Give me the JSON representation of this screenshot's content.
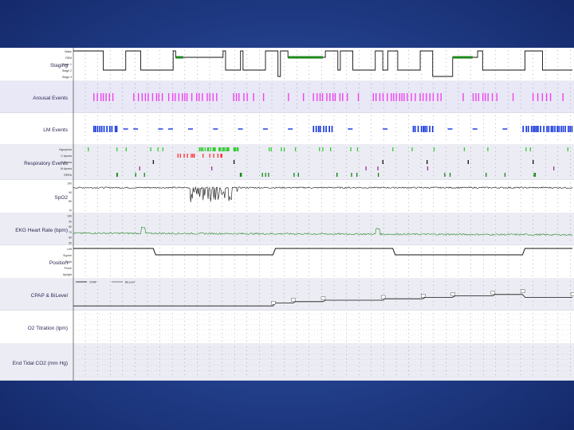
{
  "chart_data": {
    "type": "line",
    "title": "",
    "channels": [
      {
        "key": "staging",
        "label": "Staging",
        "scale_labels": [
          "Wake",
          "REM",
          "Stage 1",
          "Stage 2",
          "Stage 3"
        ],
        "description": "Hypnogram: sleep stage over time (0=Wake,1=REM,2=Stage 1,3=Stage 2,4=Stage 3)",
        "x_fraction": [
          0,
          0.05,
          0.06,
          0.1,
          0.105,
          0.13,
          0.135,
          0.14,
          0.2,
          0.205,
          0.22,
          0.3,
          0.305,
          0.33,
          0.335,
          0.34,
          0.38,
          0.385,
          0.41,
          0.415,
          0.43,
          0.5,
          0.505,
          0.53,
          0.535,
          0.56,
          0.6,
          0.605,
          0.62,
          0.63,
          0.65,
          0.69,
          0.695,
          0.72,
          0.73,
          0.76,
          0.8,
          0.81,
          0.82,
          0.9,
          0.905,
          0.94,
          0.95,
          1.0
        ],
        "stage": [
          0,
          0,
          3,
          3,
          0,
          0,
          3,
          3,
          0,
          1,
          1,
          0,
          3,
          3,
          0,
          3,
          3,
          0,
          4,
          0,
          1,
          1,
          0,
          3,
          0,
          3,
          3,
          0,
          3,
          0,
          3,
          3,
          0,
          4,
          4,
          1,
          1,
          0,
          3,
          3,
          0,
          3,
          3,
          3
        ]
      },
      {
        "key": "arousal",
        "label": "Arousal Events",
        "color": "#ee44ee"
      },
      {
        "key": "lm",
        "label": "LM Events",
        "color": "#1133dd"
      },
      {
        "key": "respiratory",
        "label": "Respiratory Events",
        "rows": [
          "Hypopnea",
          "C.Apnea",
          "O.Apnea",
          "M.Apnea",
          "RERA"
        ],
        "colors": [
          "#33cc33",
          "#ff3333",
          "#111111",
          "#993399",
          "#118811"
        ]
      },
      {
        "key": "spo2",
        "label": "SpO2",
        "ticks": [
          100,
          90,
          80,
          70
        ],
        "baseline": 95
      },
      {
        "key": "hr",
        "label": "EKG Heart Rate (bpm)",
        "ticks": [
          100,
          90,
          80,
          70,
          60,
          50
        ],
        "baseline": 68,
        "color": "#228822"
      },
      {
        "key": "position",
        "label": "Position",
        "rows": [
          "Left",
          "Supine",
          "Right",
          "Prone",
          "Upright"
        ],
        "x_fraction": [
          0,
          0.16,
          0.165,
          0.4,
          0.405,
          0.64,
          0.645,
          0.9,
          0.905,
          1.0
        ],
        "row_index": [
          0,
          0,
          1,
          1,
          0,
          0,
          1,
          1,
          0,
          0
        ]
      },
      {
        "key": "cpap",
        "label": "CPAP & BiLevel",
        "legend": [
          "CPAP",
          "BiLevel"
        ],
        "x_fraction": [
          0,
          0.4,
          0.405,
          0.44,
          0.445,
          0.5,
          0.505,
          0.62,
          0.625,
          0.7,
          0.705,
          0.76,
          0.765,
          0.84,
          0.845,
          0.9,
          0.905,
          1.0
        ],
        "pressure": [
          5,
          5,
          7,
          7,
          8,
          8,
          9,
          9,
          10,
          10,
          11,
          11,
          12,
          12,
          13,
          13,
          11,
          11
        ]
      },
      {
        "key": "o2",
        "label": "O2 Titration (lpm)"
      },
      {
        "key": "etco2",
        "label": "End Tidal CO2 (mm Hg)"
      }
    ]
  }
}
